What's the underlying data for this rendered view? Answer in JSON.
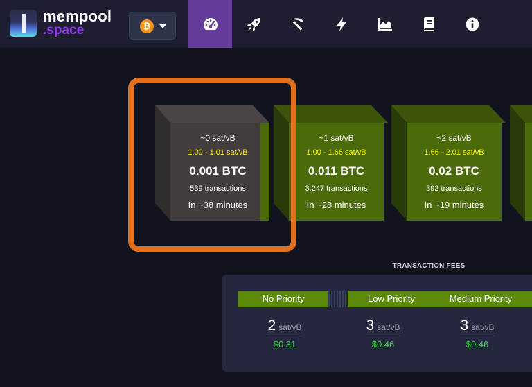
{
  "brand": {
    "name_top": "mempool",
    "name_bottom": ".space",
    "accent": "#9339f4"
  },
  "network": {
    "selected_symbol": "₿",
    "icon": "bitcoin-icon"
  },
  "nav": {
    "items": [
      {
        "icon": "dashboard-icon",
        "active": true
      },
      {
        "icon": "rocket-icon",
        "active": false
      },
      {
        "icon": "pickaxe-icon",
        "active": false
      },
      {
        "icon": "lightning-icon",
        "active": false
      },
      {
        "icon": "graph-icon",
        "active": false
      },
      {
        "icon": "book-icon",
        "active": false
      },
      {
        "icon": "info-icon",
        "active": false
      }
    ],
    "active_color": "#653b9c"
  },
  "blocks": [
    {
      "fee_median": "~0 sat/vB",
      "fee_range": "1.00 - 1.01 sat/vB",
      "size": "0.001 BTC",
      "tx_count": "539 transactions",
      "eta": "In ~38 minutes",
      "highlighted": true
    },
    {
      "fee_median": "~1 sat/vB",
      "fee_range": "1.00 - 1.66 sat/vB",
      "size": "0.011 BTC",
      "tx_count": "3,247 transactions",
      "eta": "In ~28 minutes"
    },
    {
      "fee_median": "~2 sat/vB",
      "fee_range": "1.66 - 2.01 sat/vB",
      "size": "0.02 BTC",
      "tx_count": "392 transactions",
      "eta": "In ~19 minutes"
    }
  ],
  "highlight_color": "#e1701e",
  "fees": {
    "title": "TRANSACTION FEES",
    "priorities": [
      {
        "label": "No Priority",
        "rate": "2",
        "unit": "sat/vB",
        "usd": "$0.31"
      },
      {
        "label": "Low Priority",
        "rate": "3",
        "unit": "sat/vB",
        "usd": "$0.46"
      },
      {
        "label": "Medium Priority",
        "rate": "3",
        "unit": "sat/vB",
        "usd": "$0.46"
      }
    ]
  }
}
